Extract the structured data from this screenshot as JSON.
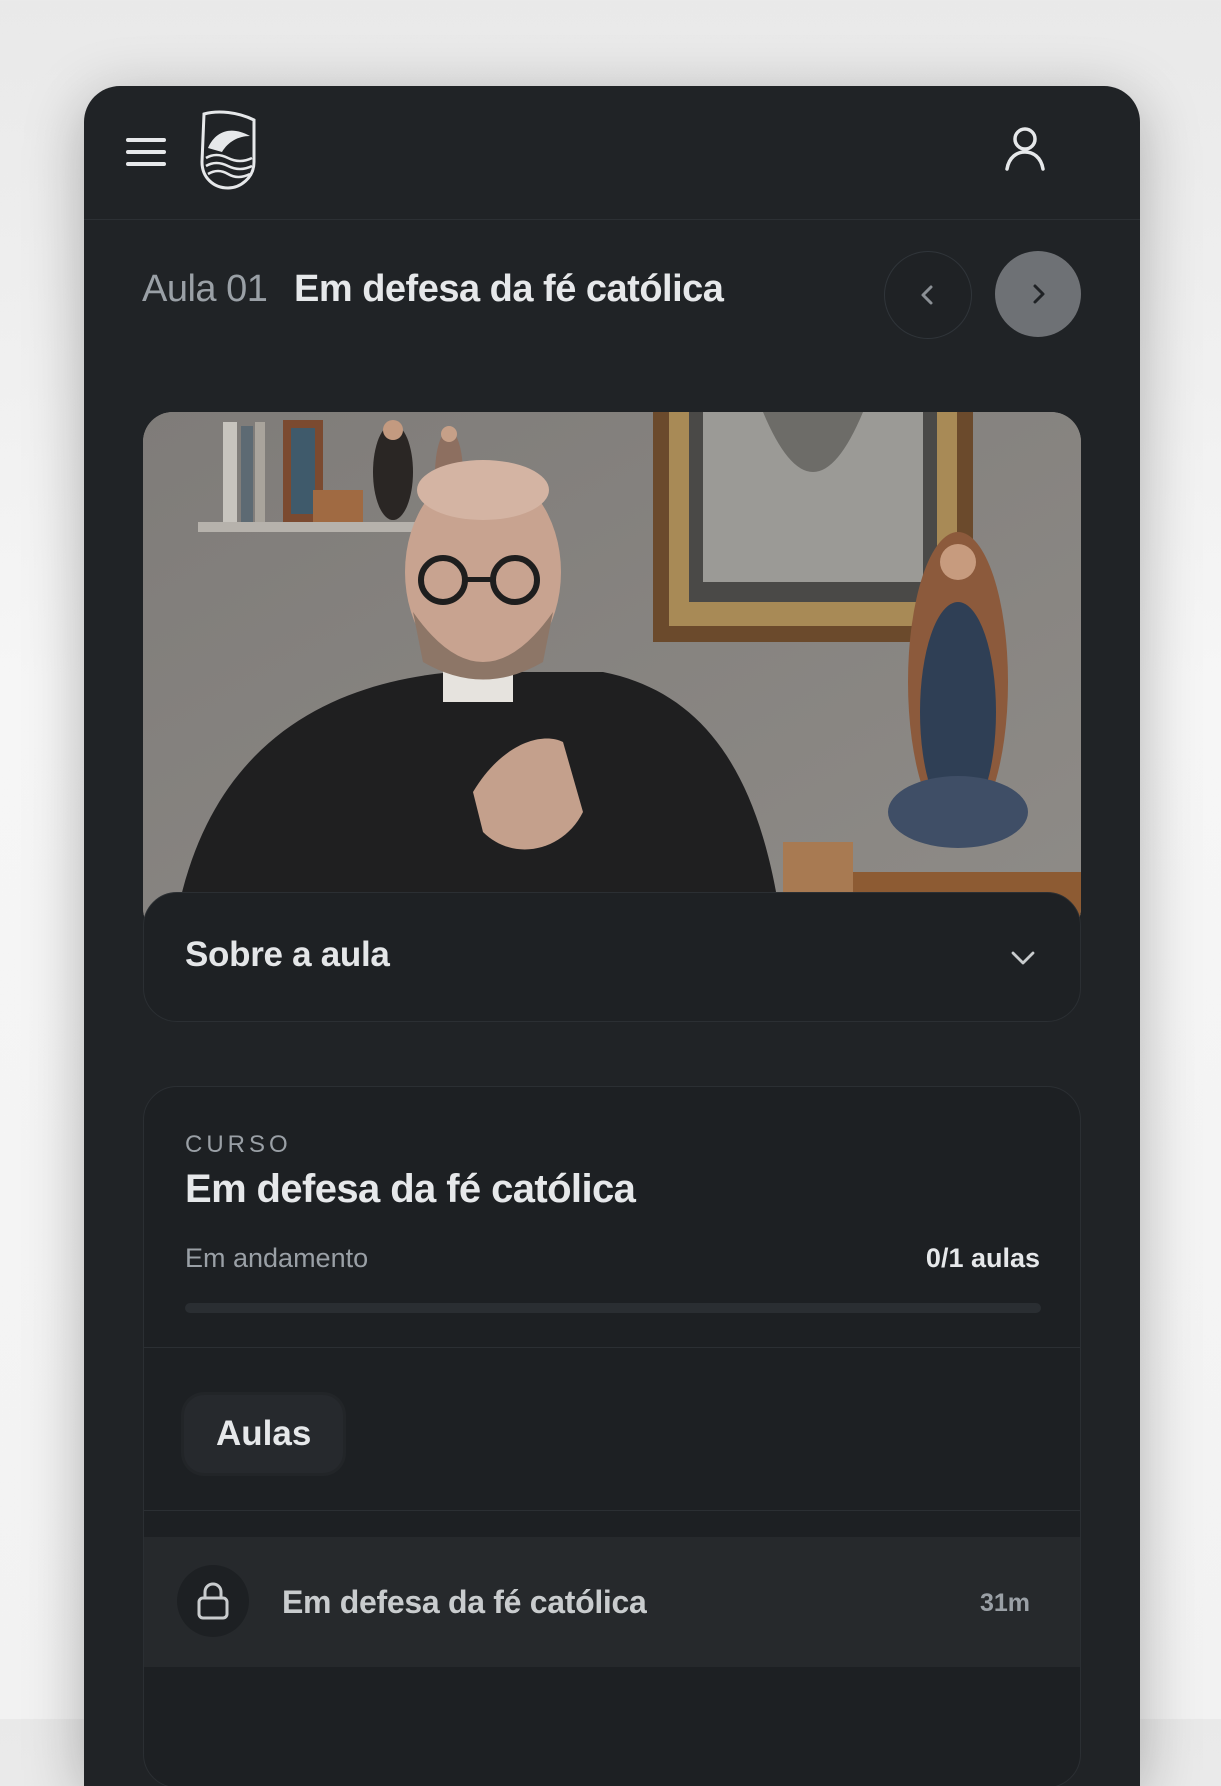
{
  "header": {
    "menu_icon": "hamburger-menu-icon",
    "logo_icon": "shield-waves-logo",
    "user_icon": "user-icon"
  },
  "lesson": {
    "number_label": "Aula 01",
    "title": "Em defesa da fé católica",
    "prev_icon": "chevron-left-icon",
    "next_icon": "chevron-right-icon"
  },
  "about": {
    "label": "Sobre a aula",
    "icon": "chevron-down-icon"
  },
  "course": {
    "kicker": "CURSO",
    "title": "Em defesa da fé católica",
    "status": "Em andamento",
    "count": "0/1 aulas",
    "progress": 0,
    "tab_label": "Aulas",
    "lessons": [
      {
        "title": "Em defesa da fé católica",
        "duration": "31m",
        "icon": "lock-icon"
      }
    ]
  },
  "colors": {
    "background": "#202326",
    "accent_muted": "#6e7175",
    "text_primary": "#e6e8ea",
    "text_secondary": "#9aa0a6"
  }
}
